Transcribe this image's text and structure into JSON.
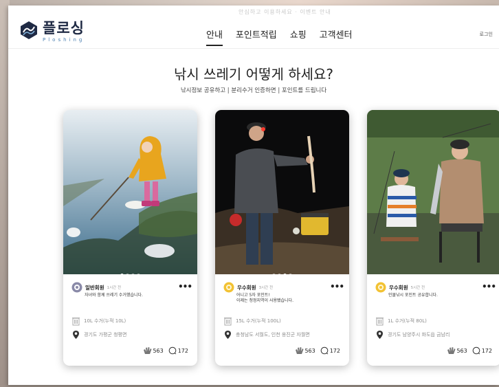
{
  "header": {
    "top_text": "안심하고 이용하세요 · 이벤트 안내",
    "logo": {
      "ko": "플로싱",
      "en": "Ploshing"
    },
    "nav": [
      {
        "label": "안내",
        "active": true
      },
      {
        "label": "포인트적립",
        "active": false
      },
      {
        "label": "쇼핑",
        "active": false
      },
      {
        "label": "고객센터",
        "active": false
      }
    ],
    "login": "로그인"
  },
  "hero": {
    "title": "낚시 쓰레기 어떻게 하세요?",
    "subtitle": "낚시정보 공유하고 | 분리수거 인증하면 | 포인트를 드립니다"
  },
  "cards": [
    {
      "member": "일반회원",
      "time": "1시간 전",
      "badge_color": "#8a8aa8",
      "desc_lines": [
        "자녀와 함께 쓰레기 수거했습니다."
      ],
      "volume": "10L 수거(누적 10L)",
      "location": "경기도 가평군 청평면",
      "likes": "563",
      "comments": "172",
      "more": "•••",
      "photo_icon": "child-in-yellow-raincoat-photo"
    },
    {
      "member": "우수회원",
      "time": "3시간 전",
      "badge_color": "#f2c233",
      "desc_lines": [
        "어니고 5자 포인트!",
        "이제는 청정지역이 사용됐습니다."
      ],
      "volume": "15L 수거(누적 100L)",
      "location": "충청남도 서월도, 인천 옹진군 자월면",
      "likes": "563",
      "comments": "172",
      "more": "•••",
      "photo_icon": "night-fishing-photo"
    },
    {
      "member": "우수회원",
      "time": "5시간 전",
      "badge_color": "#f2c233",
      "desc_lines": [
        "인물낚시 포인트 공유합니다."
      ],
      "volume": "1L 수거(누적 80L)",
      "location": "경기도 남양주시 화도읍 금남리",
      "likes": "563",
      "comments": "172",
      "more": "•••",
      "photo_icon": "riverside-fishing-photo"
    }
  ]
}
